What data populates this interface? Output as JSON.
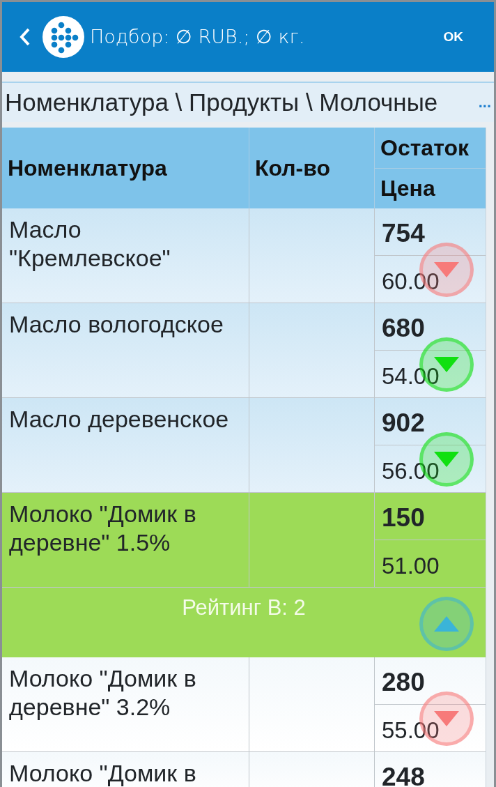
{
  "header": {
    "title": "Подбор: ∅ RUB.; ∅ кг.",
    "ok": "OK"
  },
  "breadcrumb": {
    "path": "Номенклатура \\ Продукты \\ Молочные",
    "more": "..."
  },
  "table": {
    "columns": {
      "name": "Номенклатура",
      "qty": "Кол-во",
      "stock": "Остаток",
      "price": "Цена"
    },
    "rows": [
      {
        "name": "Масло \"Кремлевское\"",
        "stock": "754",
        "price": "60.00",
        "selected": false,
        "trend": {
          "kind": "down",
          "color": "#f77a7a"
        }
      },
      {
        "name": "Масло вологодское",
        "stock": "680",
        "price": "54.00",
        "selected": false,
        "trend": {
          "kind": "down",
          "color": "#10e010"
        }
      },
      {
        "name": "Масло деревенское",
        "stock": "902",
        "price": "56.00",
        "selected": false,
        "trend": {
          "kind": "down",
          "color": "#10e010"
        }
      },
      {
        "name": "Молоко \"Домик в деревне\" 1.5%",
        "stock": "150",
        "price": "51.00",
        "selected": true,
        "detail": "Рейтинг В: 2",
        "trend": {
          "kind": "up",
          "color": "#3ab4d8"
        }
      },
      {
        "name": "Молоко \"Домик в деревне\" 3.2%",
        "stock": "280",
        "price": "55.00",
        "selected": false,
        "trend": {
          "kind": "down",
          "color": "#f77a7a"
        }
      },
      {
        "name": "Молоко \"Домик в",
        "stock": "248",
        "selected": false
      }
    ]
  }
}
